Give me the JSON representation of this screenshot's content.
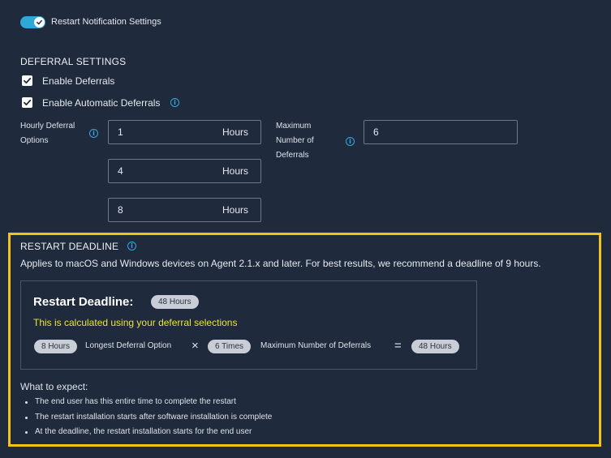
{
  "toggle": {
    "label": "Restart Notification Settings",
    "on": true
  },
  "deferral": {
    "title": "DEFERRAL SETTINGS",
    "enable_deferrals": {
      "label": "Enable Deferrals",
      "checked": true
    },
    "enable_automatic": {
      "label": "Enable Automatic Deferrals",
      "checked": true
    },
    "hourly_label_line1": "Hourly Deferral",
    "hourly_label_line2": "Options",
    "hourly_options": [
      {
        "value": "1",
        "suffix": "Hours"
      },
      {
        "value": "4",
        "suffix": "Hours"
      },
      {
        "value": "8",
        "suffix": "Hours"
      }
    ],
    "max_label_line1": "Maximum",
    "max_label_line2": "Number of",
    "max_label_line3": "Deferrals",
    "max_value": "6"
  },
  "deadline": {
    "title": "RESTART DEADLINE",
    "description": "Applies to macOS and Windows devices on Agent 2.1.x and later. For best results, we recommend a deadline of 9 hours.",
    "card_title": "Restart Deadline:",
    "card_badge": "48 Hours",
    "calc_note": "This is calculated using your deferral selections",
    "formula": {
      "a_value": "8 Hours",
      "a_label": "Longest Deferral Option",
      "times": "×",
      "b_value": "6 Times",
      "b_label": "Maximum Number of Deferrals",
      "equals": "=",
      "result": "48 Hours"
    },
    "expect_title": "What to expect:",
    "expect_items": [
      "The end user has this entire time to complete the restart",
      "The restart installation starts after software installation is complete",
      "At the deadline, the restart installation starts for the end user"
    ]
  },
  "colors": {
    "accent": "#2ea8d6",
    "highlight": "#f3c316",
    "note": "#e9e33a",
    "background": "#1f2a3c"
  },
  "icons": {
    "info": "info-icon",
    "check": "check-icon"
  }
}
